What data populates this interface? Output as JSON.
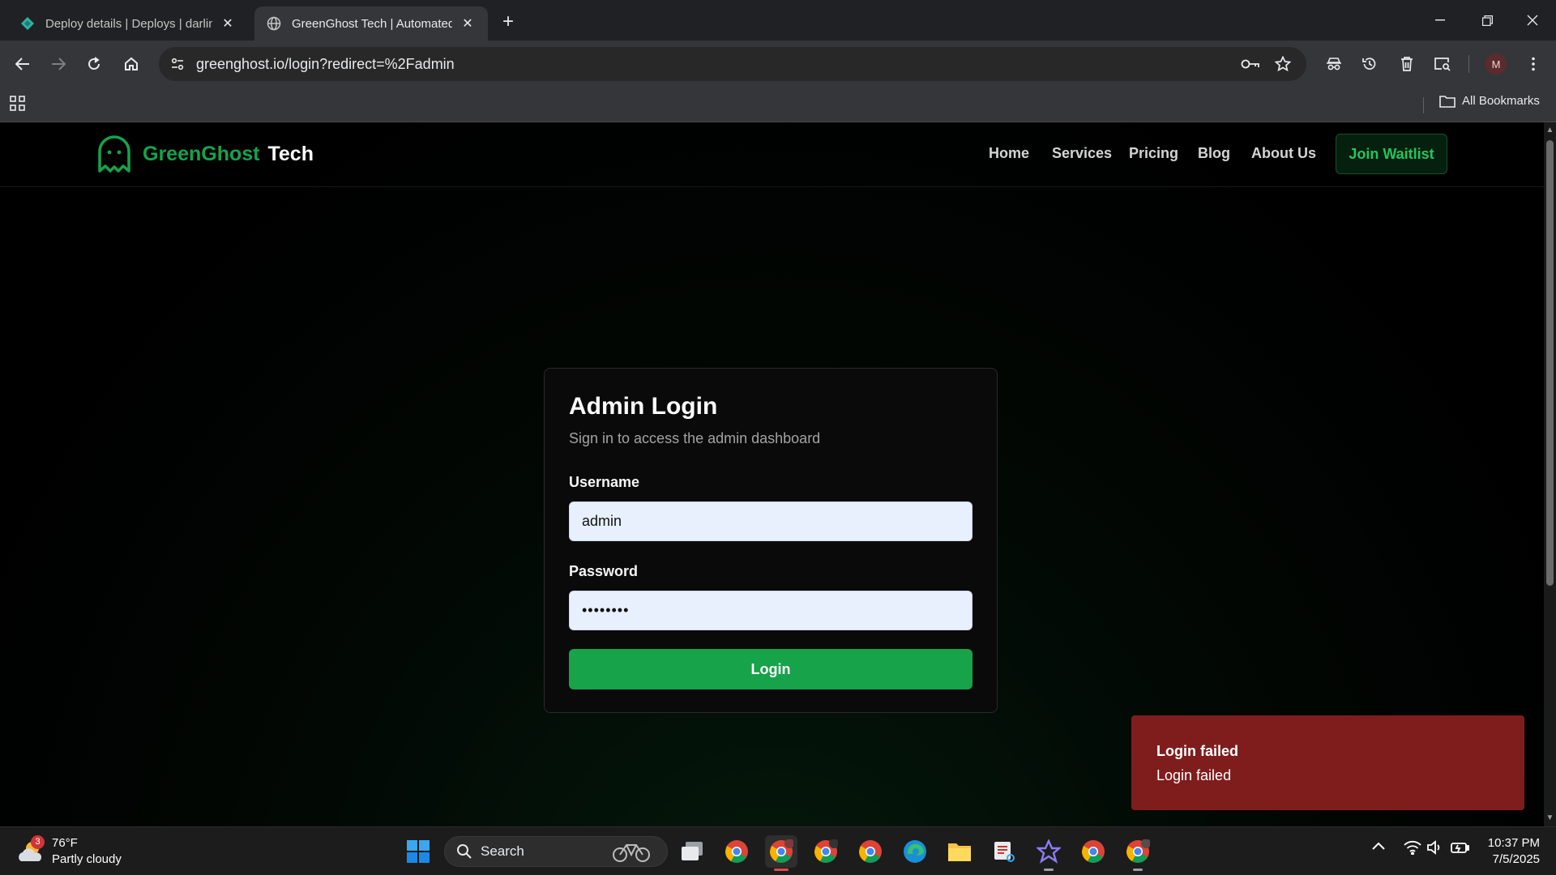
{
  "browser": {
    "tabs": [
      {
        "title": "Deploy details | Deploys | darlin",
        "active": false
      },
      {
        "title": "GreenGhost Tech | Automated L",
        "active": true
      }
    ],
    "new_tab": "+",
    "url": "greenghost.io/login?redirect=%2Fadmin",
    "profile_initial": "M",
    "bookmarks": {
      "all_label": "All Bookmarks"
    }
  },
  "site": {
    "brand_primary": "GreenGhost",
    "brand_secondary": "Tech",
    "nav": [
      "Home",
      "Services",
      "Pricing",
      "Blog",
      "About Us"
    ],
    "cta": "Join Waitlist",
    "accent": "#16a34a"
  },
  "login": {
    "title": "Admin Login",
    "subtitle": "Sign in to access the admin dashboard",
    "username_label": "Username",
    "username_value": "admin",
    "password_label": "Password",
    "password_value": "••••••••",
    "submit": "Login"
  },
  "toast": {
    "title": "Login failed",
    "message": "Login failed",
    "color": "#7f1d1d"
  },
  "taskbar": {
    "weather": {
      "temp": "76°F",
      "condition": "Partly cloudy",
      "badge": "3"
    },
    "search": "Search",
    "time": "10:37 PM",
    "date": "7/5/2025"
  }
}
